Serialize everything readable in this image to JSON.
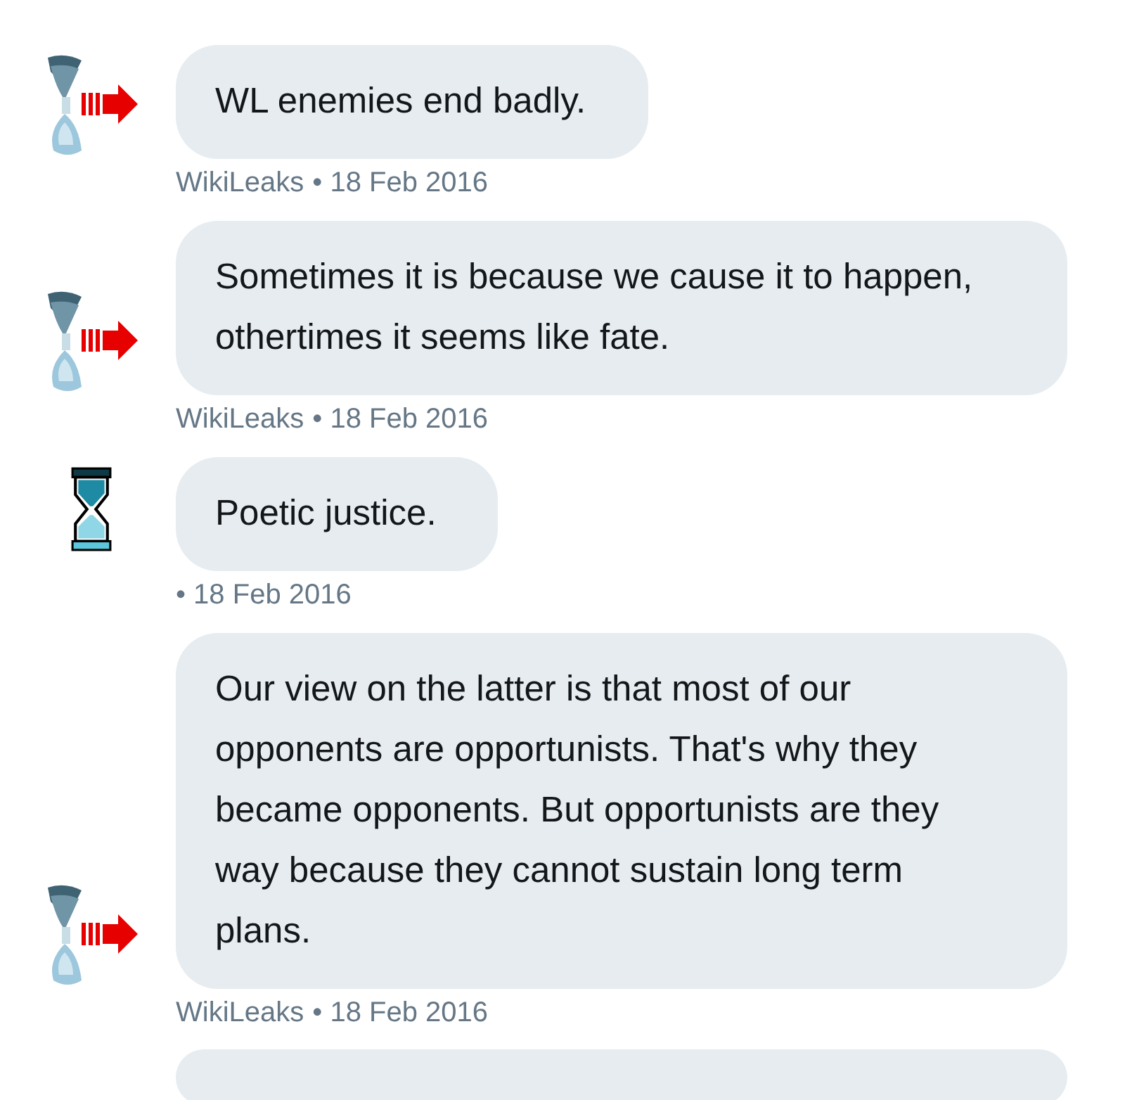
{
  "messages": [
    {
      "avatar": {
        "kind": "wikileaks-arrow"
      },
      "text": "WL enemies end badly.",
      "sender": "WikiLeaks",
      "date": "• 18 Feb 2016"
    },
    {
      "avatar": {
        "kind": "wikileaks-arrow"
      },
      "text": "Sometimes it is because we cause it to happen, othertimes it seems like fate.",
      "sender": "WikiLeaks",
      "date": "• 18 Feb 2016"
    },
    {
      "avatar": {
        "kind": "hourglass"
      },
      "text": "Poetic justice.",
      "date": "• 18 Feb 2016"
    },
    {
      "avatar": {
        "kind": "wikileaks-arrow"
      },
      "text": "Our view on the latter is that most of our opponents are opportunists. That's why they became opponents. But opportunists are they way because they cannot sustain long term plans.",
      "sender": "WikiLeaks",
      "date": "• 18 Feb 2016"
    }
  ]
}
